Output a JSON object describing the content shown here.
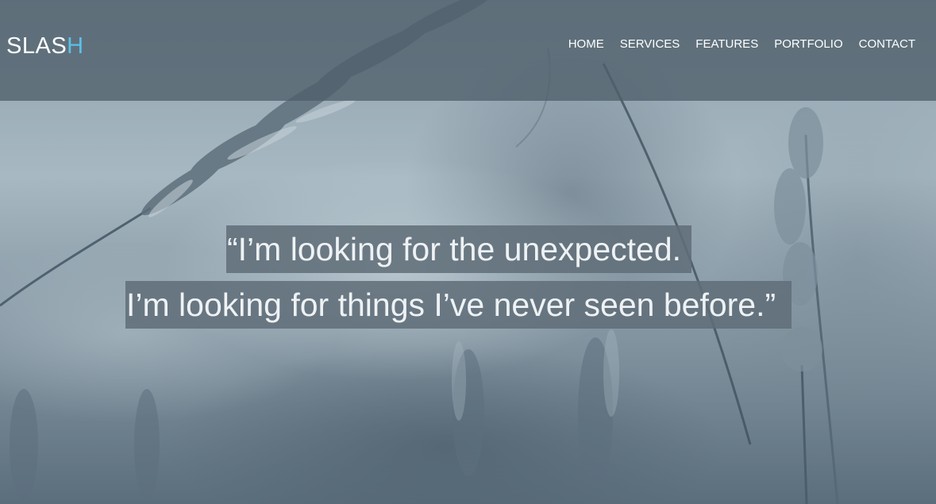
{
  "brand": {
    "logo_main": "SLAS",
    "logo_accent": "H",
    "accent_color": "#5bc0e8"
  },
  "nav": {
    "items": [
      {
        "label": "HOME"
      },
      {
        "label": "SERVICES"
      },
      {
        "label": "FEATURES"
      },
      {
        "label": "PORTFOLIO"
      },
      {
        "label": "CONTACT"
      }
    ]
  },
  "hero": {
    "quote_line_1": "“I’m looking for the unexpected.",
    "quote_line_2": "I’m looking for things I’ve never seen before.”"
  }
}
